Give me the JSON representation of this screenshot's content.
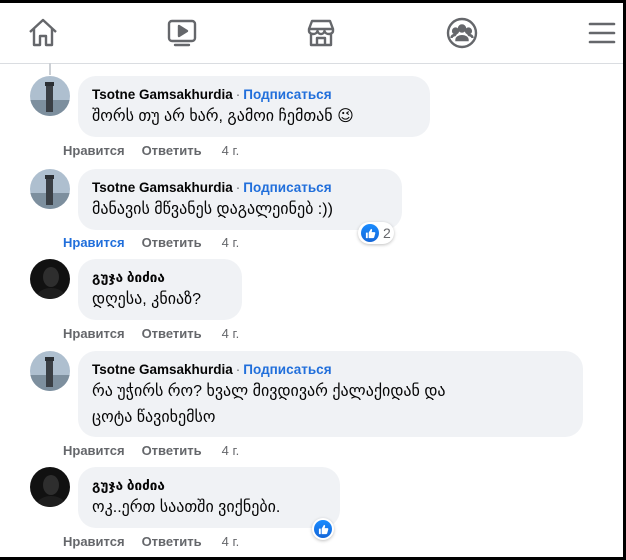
{
  "nav": {
    "items": [
      "home-icon",
      "video-icon",
      "marketplace-icon",
      "groups-icon",
      "menu-icon"
    ]
  },
  "comments": [
    {
      "author": "Tsotne Gamsakhurdia",
      "follow": "Подписаться",
      "separator": "·",
      "lines": [
        "შორს თუ არ ხარ, გამოი ჩემთან 😉"
      ],
      "like": "Нравится",
      "reply": "Ответить",
      "time": "4 г.",
      "liked": false
    },
    {
      "author": "Tsotne Gamsakhurdia",
      "follow": "Подписаться",
      "separator": "·",
      "lines": [
        "მანავის მწვანეს დაგალეინებ :))"
      ],
      "like": "Нравится",
      "reply": "Ответить",
      "time": "4 г.",
      "liked": true,
      "reaction_count": "2"
    },
    {
      "author": "გუჯა ბიძია",
      "lines": [
        "დღესა, კნიაზ?"
      ],
      "like": "Нравится",
      "reply": "Ответить",
      "time": "4 г.",
      "liked": false
    },
    {
      "author": "Tsotne Gamsakhurdia",
      "follow": "Подписаться",
      "separator": "·",
      "lines": [
        "რა უჭირს რო? ხვალ მივდივარ ქალაქიდან და",
        "ცოტა წავიხემსო"
      ],
      "like": "Нравится",
      "reply": "Ответить",
      "time": "4 г.",
      "liked": false
    },
    {
      "author": "გუჯა ბიძია",
      "lines": [
        "ოკ..ერთ საათში ვიქნები."
      ],
      "like": "Нравится",
      "reply": "Ответить",
      "time": "4 г.",
      "liked": false
    }
  ],
  "colors": {
    "link": "#216fdb",
    "bubble": "#f0f2f5",
    "secondary_text": "#65676b"
  }
}
